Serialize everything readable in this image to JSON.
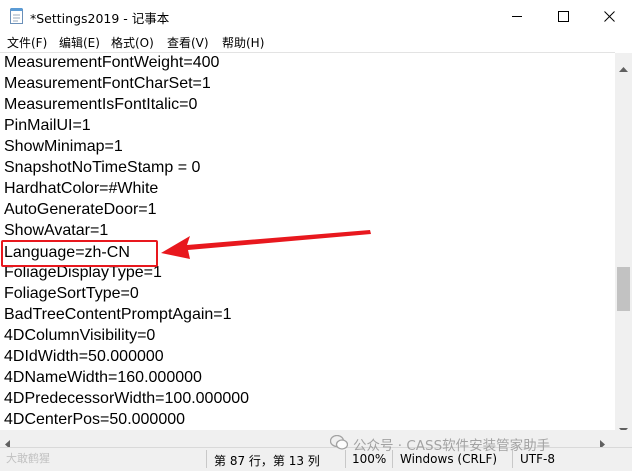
{
  "window": {
    "title": "*Settings2019 - 记事本",
    "icon": "notepad-icon",
    "controls": [
      "minimize-icon",
      "maximize-icon",
      "close-icon"
    ]
  },
  "menu": {
    "items": [
      "文件(F)",
      "编辑(E)",
      "格式(O)",
      "查看(V)",
      "帮助(H)"
    ]
  },
  "editor": {
    "lines": [
      "MeasurementFontWeight=400",
      "MeasurementFontCharSet=1",
      "MeasurementIsFontItalic=0",
      "PinMailUI=1",
      "ShowMinimap=1",
      "SnapshotNoTimeStamp = 0",
      "HardhatColor=#White",
      "AutoGenerateDoor=1",
      "ShowAvatar=1",
      "Language=zh-CN",
      "FoliageDisplayType=1",
      "FoliageSortType=0",
      "BadTreeContentPromptAgain=1",
      "4DColumnVisibility=0",
      "4DIdWidth=50.000000",
      "4DNameWidth=160.000000",
      "4DPredecessorWidth=100.000000",
      "4DCenterPos=50.000000"
    ],
    "highlighted_line": "Language=zh-CN",
    "annotation_color": "#e8181e"
  },
  "statusbar": {
    "position": "第 87 行，第 13 列",
    "zoom": "100%",
    "line_ending": "Windows (CRLF)",
    "encoding": "UTF-8"
  },
  "watermarks": {
    "left": "大敢鹤猩",
    "right": "公众号 · CASS软件安装管家助手"
  }
}
